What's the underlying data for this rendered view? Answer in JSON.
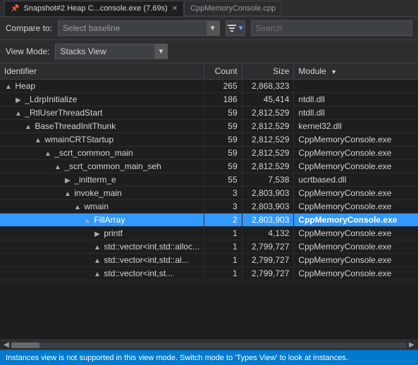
{
  "titlebar": {
    "tab1_label": "Snapshot#2 Heap C...console.exe (7.69s)",
    "tab1_size": "7.69s",
    "tab2_label": "CppMemoryConsole.cpp",
    "pin_icon": "📌",
    "close_icon": "✕"
  },
  "toolbar": {
    "compare_label": "Compare to:",
    "baseline_placeholder": "Select baseline",
    "search_placeholder": "Search",
    "filter_icon": "▼"
  },
  "viewmode": {
    "label": "View Mode:",
    "selected": "Stacks View"
  },
  "table": {
    "columns": [
      {
        "key": "identifier",
        "label": "Identifier"
      },
      {
        "key": "count",
        "label": "Count"
      },
      {
        "key": "size",
        "label": "Size"
      },
      {
        "key": "module",
        "label": "Module"
      }
    ],
    "rows": [
      {
        "id": 1,
        "indent": 0,
        "expand": "▲",
        "name": "Heap",
        "count": "265",
        "size": "2,868,323",
        "module": "",
        "selected": false
      },
      {
        "id": 2,
        "indent": 1,
        "expand": "▶",
        "name": "_LdrpInitialize",
        "count": "186",
        "size": "45,414",
        "module": "ntdll.dll",
        "selected": false
      },
      {
        "id": 3,
        "indent": 1,
        "expand": "▲",
        "name": "_RtlUserThreadStart",
        "count": "59",
        "size": "2,812,529",
        "module": "ntdll.dll",
        "selected": false
      },
      {
        "id": 4,
        "indent": 2,
        "expand": "▲",
        "name": "BaseThreadInitThunk",
        "count": "59",
        "size": "2,812,529",
        "module": "kernel32.dll",
        "selected": false
      },
      {
        "id": 5,
        "indent": 3,
        "expand": "▲",
        "name": "wmainCRTStartup",
        "count": "59",
        "size": "2,812,529",
        "module": "CppMemoryConsole.exe",
        "selected": false
      },
      {
        "id": 6,
        "indent": 4,
        "expand": "▲",
        "name": "_scrt_common_main",
        "count": "59",
        "size": "2,812,529",
        "module": "CppMemoryConsole.exe",
        "selected": false
      },
      {
        "id": 7,
        "indent": 5,
        "expand": "▲",
        "name": "_scrt_common_main_seh",
        "count": "59",
        "size": "2,812,529",
        "module": "CppMemoryConsole.exe",
        "selected": false
      },
      {
        "id": 8,
        "indent": 6,
        "expand": "▶",
        "name": "_initterm_e",
        "count": "55",
        "size": "7,538",
        "module": "ucrtbased.dll",
        "selected": false
      },
      {
        "id": 9,
        "indent": 6,
        "expand": "▲",
        "name": "invoke_main",
        "count": "3",
        "size": "2,803,903",
        "module": "CppMemoryConsole.exe",
        "selected": false
      },
      {
        "id": 10,
        "indent": 7,
        "expand": "▲",
        "name": "wmain",
        "count": "3",
        "size": "2,803,903",
        "module": "CppMemoryConsole.exe",
        "selected": false
      },
      {
        "id": 11,
        "indent": 8,
        "expand": "▲",
        "name": "FillArray",
        "count": "2",
        "size": "2,803,903",
        "module": "CppMemoryConsole.exe",
        "selected": true
      },
      {
        "id": 12,
        "indent": 9,
        "expand": "▶",
        "name": "printf",
        "count": "1",
        "size": "4,132",
        "module": "CppMemoryConsole.exe",
        "selected": false
      },
      {
        "id": 13,
        "indent": 9,
        "expand": "▲",
        "name": "std::vector<int,std::alloc...",
        "count": "1",
        "size": "2,799,727",
        "module": "CppMemoryConsole.exe",
        "selected": false
      },
      {
        "id": 14,
        "indent": 9,
        "expand": "▲",
        "name": "std::vector<int,std::al...",
        "count": "1",
        "size": "2,799,727",
        "module": "CppMemoryConsole.exe",
        "selected": false
      },
      {
        "id": 15,
        "indent": 9,
        "expand": "▲",
        "name": "std::vector<int,st...",
        "count": "1",
        "size": "2,799,727",
        "module": "CppMemoryConsole.exe",
        "selected": false
      }
    ]
  },
  "statusbar": {
    "message": "Instances view is not supported in this view mode. Switch mode to 'Types View' to look at instances."
  }
}
